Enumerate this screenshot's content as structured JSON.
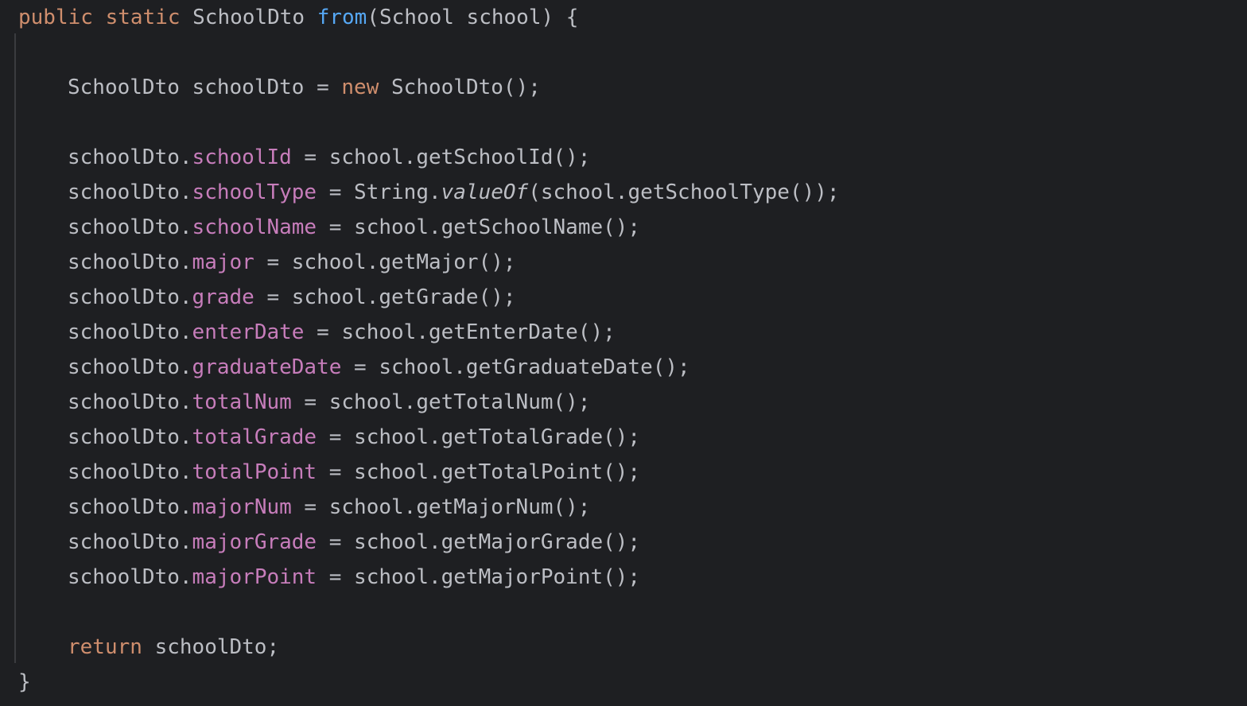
{
  "code": {
    "signature": {
      "kw1": "public",
      "kw2": "static",
      "ret_type": "SchoolDto",
      "method_name": "from",
      "params": "(School school) {"
    },
    "decl": {
      "type": "SchoolDto",
      "var": "schoolDto",
      "eq": "=",
      "kw_new": "new",
      "ctor": "SchoolDto();"
    },
    "assign_prefix": "schoolDto.",
    "assignments": [
      {
        "field": "schoolId",
        "rhs": " = school.getSchoolId();"
      },
      {
        "field": "schoolType",
        "rhs_pre": " = String.",
        "rhs_italic": "valueOf",
        "rhs_post": "(school.getSchoolType());"
      },
      {
        "field": "schoolName",
        "rhs": " = school.getSchoolName();"
      },
      {
        "field": "major",
        "rhs": " = school.getMajor();"
      },
      {
        "field": "grade",
        "rhs": " = school.getGrade();"
      },
      {
        "field": "enterDate",
        "rhs": " = school.getEnterDate();"
      },
      {
        "field": "graduateDate",
        "rhs": " = school.getGraduateDate();"
      },
      {
        "field": "totalNum",
        "rhs": " = school.getTotalNum();"
      },
      {
        "field": "totalGrade",
        "rhs": " = school.getTotalGrade();"
      },
      {
        "field": "totalPoint",
        "rhs": " = school.getTotalPoint();"
      },
      {
        "field": "majorNum",
        "rhs": " = school.getMajorNum();"
      },
      {
        "field": "majorGrade",
        "rhs": " = school.getMajorGrade();"
      },
      {
        "field": "majorPoint",
        "rhs": " = school.getMajorPoint();"
      }
    ],
    "return_kw": "return",
    "return_val": " schoolDto;",
    "close_brace": "}"
  },
  "colors": {
    "background": "#1e1f22",
    "text": "#bcbec4",
    "keyword": "#cf8e6d",
    "method": "#56a8f5",
    "field": "#c77dbb"
  }
}
